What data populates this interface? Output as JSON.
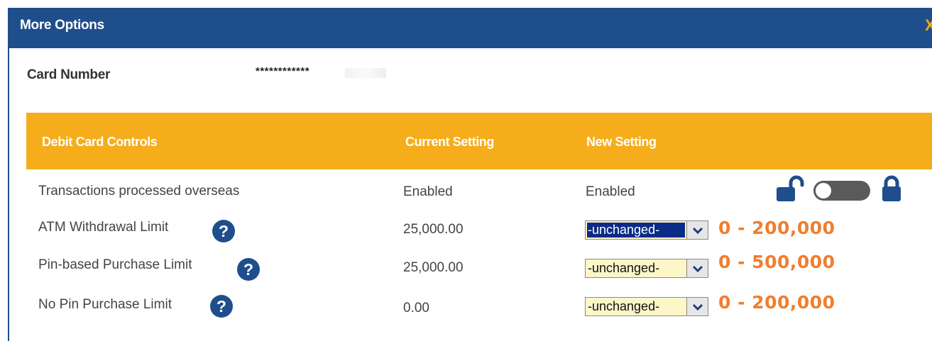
{
  "dialog": {
    "title": "More Options",
    "close_label": "X"
  },
  "card": {
    "label": "Card Number",
    "masked_value": "************"
  },
  "table": {
    "headers": [
      "Debit Card Controls",
      "Current Setting",
      "New Setting"
    ],
    "rows": [
      {
        "label": "Transactions processed overseas",
        "current": "Enabled",
        "new": "Enabled"
      },
      {
        "label": "ATM Withdrawal Limit",
        "current": "25,000.00",
        "new": "-unchanged-",
        "range": "0 - 200,000"
      },
      {
        "label": "Pin-based Purchase Limit",
        "current": "25,000.00",
        "new": "-unchanged-",
        "range": "0 - 500,000"
      },
      {
        "label": "No Pin Purchase Limit",
        "current": "0.00",
        "new": "-unchanged-",
        "range": "0 - 200,000"
      }
    ]
  },
  "help_glyph": "?",
  "toggle": {
    "state": "off",
    "icons": [
      "unlock-icon",
      "lock-icon"
    ]
  },
  "colors": {
    "title_bar": "#1f4e8c",
    "header_band": "#f5ad1b",
    "range_text": "#f07e2e",
    "select_bg": "#fdf7c8",
    "select_focus": "#0b2b88"
  }
}
